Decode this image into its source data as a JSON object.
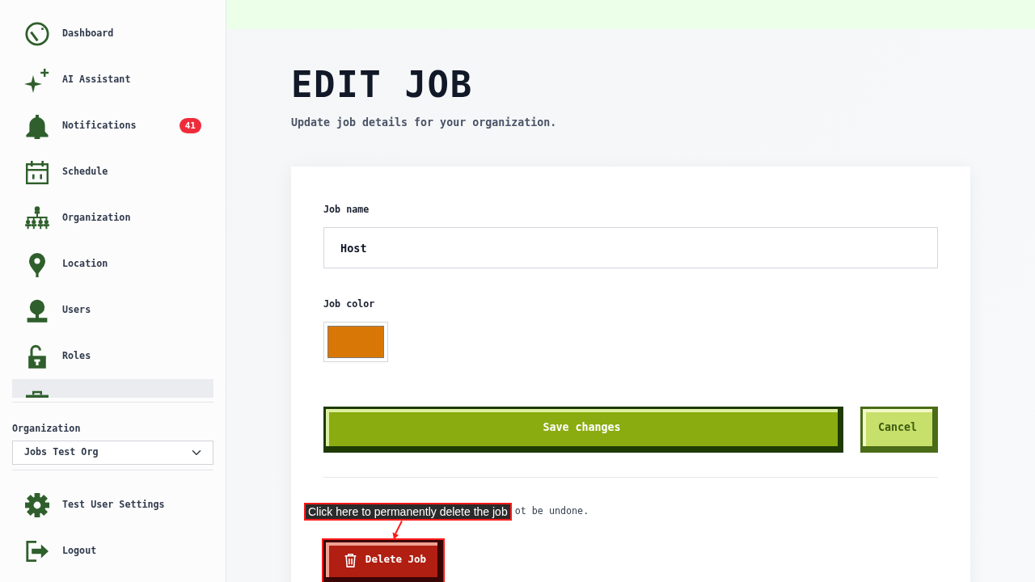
{
  "sidebar": {
    "items": [
      {
        "label": "Dashboard",
        "selected": false
      },
      {
        "label": "AI Assistant",
        "selected": false
      },
      {
        "label": "Notifications",
        "badge": "41",
        "selected": false
      },
      {
        "label": "Schedule",
        "selected": false
      },
      {
        "label": "Organization",
        "selected": false
      },
      {
        "label": "Location",
        "selected": false
      },
      {
        "label": "Users",
        "selected": false
      },
      {
        "label": "Roles",
        "selected": false
      },
      {
        "selected": true
      }
    ],
    "org_switcher": {
      "label": "Organization",
      "value": "Jobs Test Org"
    },
    "footer_items": [
      {
        "label": "Test User Settings"
      },
      {
        "label": "Logout"
      }
    ]
  },
  "header": {
    "title": "EDIT JOB",
    "subtitle": "Update job details for your organization."
  },
  "form": {
    "fields": [
      {
        "kind": "text",
        "label": "Job name",
        "value": "Host"
      },
      {
        "kind": "color",
        "label": "Job color",
        "color": "#d97706"
      }
    ],
    "buttons": [
      {
        "kind": "primary",
        "label": "Save changes"
      },
      {
        "kind": "secondary",
        "label": "Cancel"
      }
    ],
    "danger": {
      "warning": "ot be undone.",
      "button": "Delete Job"
    }
  },
  "annotation": {
    "text": "Click here to permanently delete the job"
  }
}
